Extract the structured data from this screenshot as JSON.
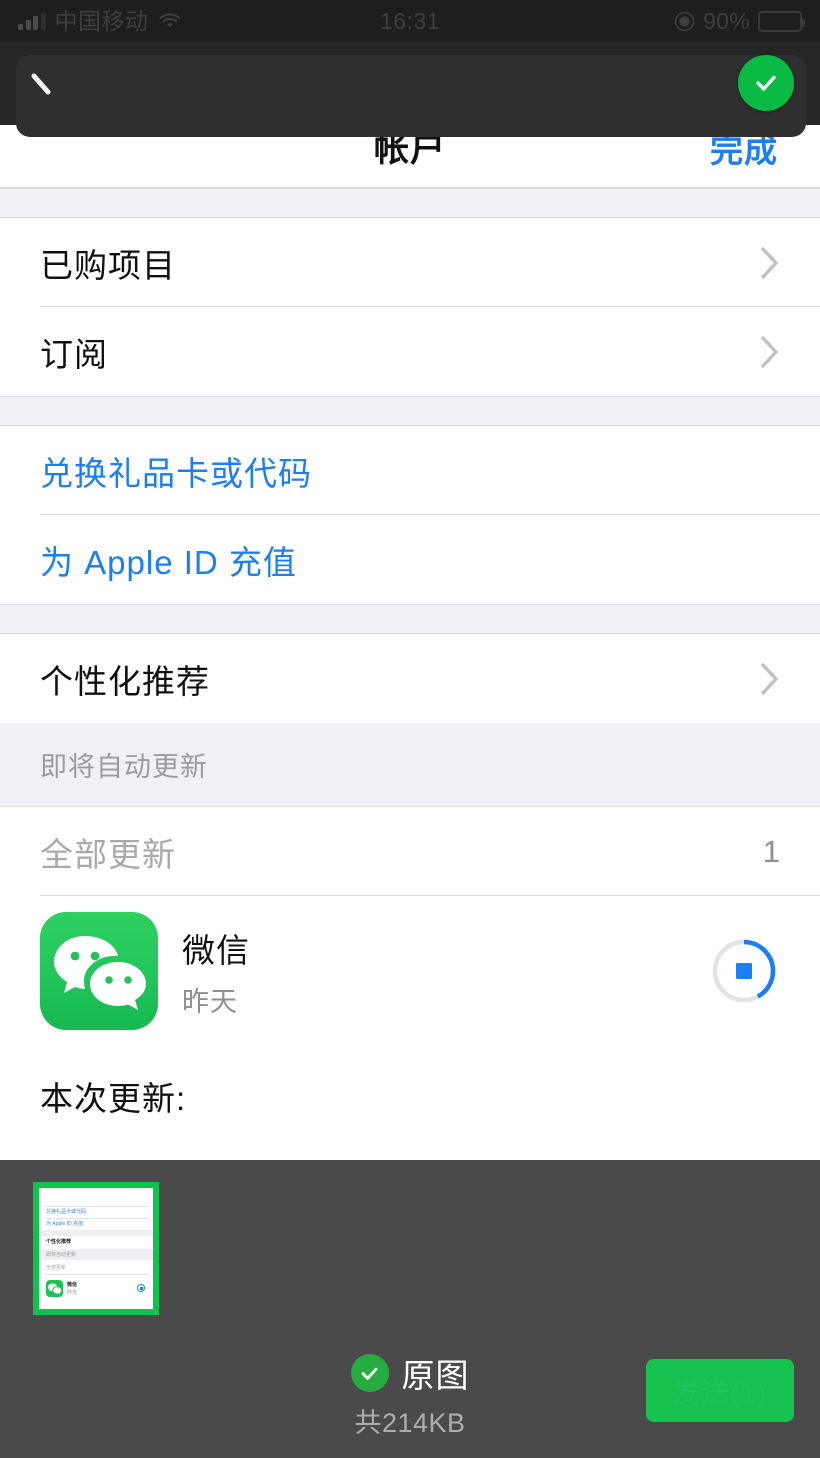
{
  "status_bar": {
    "carrier": "中国移动",
    "time": "16:31",
    "battery_percent": "90%",
    "signal_icon": "signal-bars-icon",
    "wifi_icon": "wifi-icon",
    "lock_icon": "rotation-lock-icon",
    "battery_icon": "battery-icon"
  },
  "overlay_toolbar": {
    "back_icon": "back-chevron-icon",
    "confirm_icon": "checkmark-icon",
    "confirm_color": "#09bb42"
  },
  "navbar": {
    "title": "帐户",
    "done_label": "完成",
    "done_color": "#1b7ef2"
  },
  "list": {
    "group1": [
      {
        "label": "已购项目",
        "accessory": "chevron-right-icon"
      },
      {
        "label": "订阅",
        "accessory": "chevron-right-icon"
      }
    ],
    "group2": [
      {
        "label": "兑换礼品卡或代码",
        "style": "link"
      },
      {
        "label": "为 Apple ID 充值",
        "style": "link"
      }
    ],
    "group3": [
      {
        "label": "个性化推荐",
        "accessory": "chevron-right-icon"
      }
    ],
    "updates_header": "即将自动更新",
    "update_all": {
      "label": "全部更新",
      "count": "1"
    },
    "app": {
      "name": "微信",
      "subtitle": "昨天",
      "icon": "wechat-icon",
      "progress_percent": 42,
      "progress_action_icon": "stop-square-icon",
      "progress_color": "#1b7ef2"
    },
    "whats_new_label": "本次更新:"
  },
  "picker": {
    "thumbnail_name": "selected-photo-thumbnail",
    "thumbnail_selected": true,
    "original_label": "原图",
    "original_checked": true,
    "total_size": "共214KB",
    "send_label": "发送(1)",
    "accent_color": "#16c250",
    "background_color": "#4a4a4a"
  },
  "thumbnail_preview": {
    "line1": "兑换礼品卡或代码",
    "line2": "为 Apple ID 充值",
    "line3": "个性化推荐",
    "line4": "即将自动更新",
    "line5": "全部更新",
    "app_name": "微信",
    "app_sub": "昨天"
  }
}
